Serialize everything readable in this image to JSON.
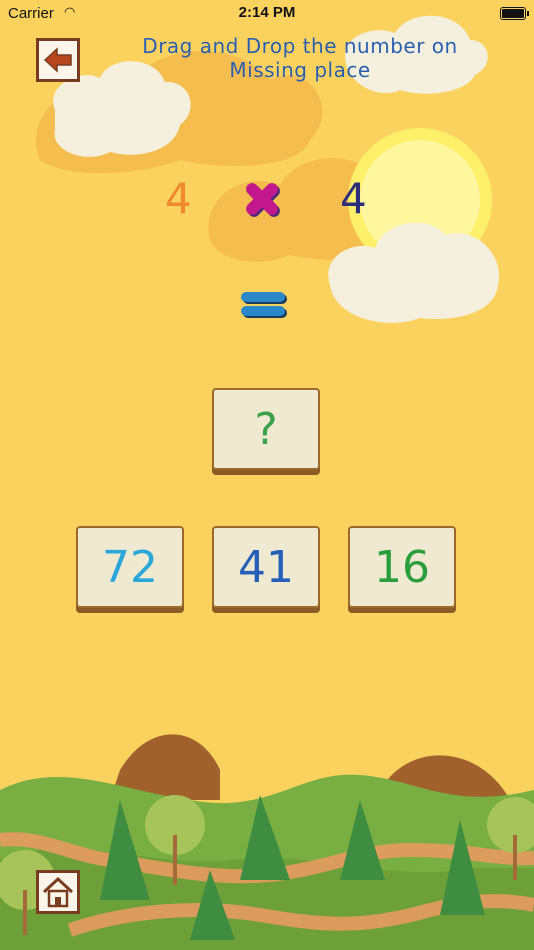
{
  "status_bar": {
    "carrier": "Carrier",
    "time": "2:14 PM"
  },
  "instructions": "Drag and Drop the number on Missing place",
  "equation": {
    "left_operand": "4",
    "right_operand": "4",
    "operator_icon": "multiply-icon",
    "equals_icon": "equals-icon",
    "answer_placeholder": "?"
  },
  "options": [
    "72",
    "41",
    "16"
  ],
  "colors": {
    "background": "#fbd25e",
    "instruction_text": "#2b5fb0",
    "left_operand": "#f08a2a",
    "right_operand": "#2b2e7a",
    "operator": "#c2188c",
    "equals": "#2a87c8",
    "tile_face": "#efe9d2",
    "tile_border": "#9b6a2a"
  },
  "icons": {
    "back": "arrow-left-icon",
    "home": "home-icon"
  }
}
